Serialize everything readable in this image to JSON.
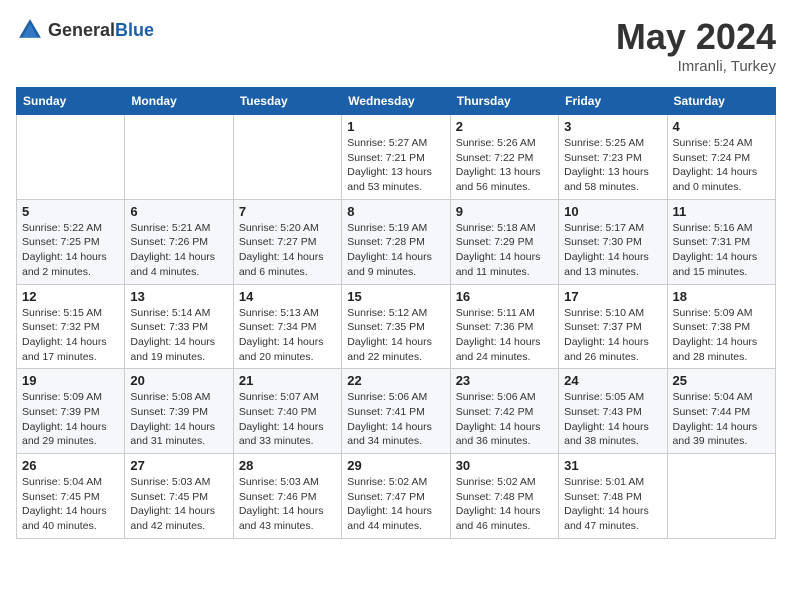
{
  "header": {
    "logo_general": "General",
    "logo_blue": "Blue",
    "month": "May 2024",
    "location": "Imranli, Turkey"
  },
  "weekdays": [
    "Sunday",
    "Monday",
    "Tuesday",
    "Wednesday",
    "Thursday",
    "Friday",
    "Saturday"
  ],
  "weeks": [
    [
      {
        "day": "",
        "info": ""
      },
      {
        "day": "",
        "info": ""
      },
      {
        "day": "",
        "info": ""
      },
      {
        "day": "1",
        "info": "Sunrise: 5:27 AM\nSunset: 7:21 PM\nDaylight: 13 hours\nand 53 minutes."
      },
      {
        "day": "2",
        "info": "Sunrise: 5:26 AM\nSunset: 7:22 PM\nDaylight: 13 hours\nand 56 minutes."
      },
      {
        "day": "3",
        "info": "Sunrise: 5:25 AM\nSunset: 7:23 PM\nDaylight: 13 hours\nand 58 minutes."
      },
      {
        "day": "4",
        "info": "Sunrise: 5:24 AM\nSunset: 7:24 PM\nDaylight: 14 hours\nand 0 minutes."
      }
    ],
    [
      {
        "day": "5",
        "info": "Sunrise: 5:22 AM\nSunset: 7:25 PM\nDaylight: 14 hours\nand 2 minutes."
      },
      {
        "day": "6",
        "info": "Sunrise: 5:21 AM\nSunset: 7:26 PM\nDaylight: 14 hours\nand 4 minutes."
      },
      {
        "day": "7",
        "info": "Sunrise: 5:20 AM\nSunset: 7:27 PM\nDaylight: 14 hours\nand 6 minutes."
      },
      {
        "day": "8",
        "info": "Sunrise: 5:19 AM\nSunset: 7:28 PM\nDaylight: 14 hours\nand 9 minutes."
      },
      {
        "day": "9",
        "info": "Sunrise: 5:18 AM\nSunset: 7:29 PM\nDaylight: 14 hours\nand 11 minutes."
      },
      {
        "day": "10",
        "info": "Sunrise: 5:17 AM\nSunset: 7:30 PM\nDaylight: 14 hours\nand 13 minutes."
      },
      {
        "day": "11",
        "info": "Sunrise: 5:16 AM\nSunset: 7:31 PM\nDaylight: 14 hours\nand 15 minutes."
      }
    ],
    [
      {
        "day": "12",
        "info": "Sunrise: 5:15 AM\nSunset: 7:32 PM\nDaylight: 14 hours\nand 17 minutes."
      },
      {
        "day": "13",
        "info": "Sunrise: 5:14 AM\nSunset: 7:33 PM\nDaylight: 14 hours\nand 19 minutes."
      },
      {
        "day": "14",
        "info": "Sunrise: 5:13 AM\nSunset: 7:34 PM\nDaylight: 14 hours\nand 20 minutes."
      },
      {
        "day": "15",
        "info": "Sunrise: 5:12 AM\nSunset: 7:35 PM\nDaylight: 14 hours\nand 22 minutes."
      },
      {
        "day": "16",
        "info": "Sunrise: 5:11 AM\nSunset: 7:36 PM\nDaylight: 14 hours\nand 24 minutes."
      },
      {
        "day": "17",
        "info": "Sunrise: 5:10 AM\nSunset: 7:37 PM\nDaylight: 14 hours\nand 26 minutes."
      },
      {
        "day": "18",
        "info": "Sunrise: 5:09 AM\nSunset: 7:38 PM\nDaylight: 14 hours\nand 28 minutes."
      }
    ],
    [
      {
        "day": "19",
        "info": "Sunrise: 5:09 AM\nSunset: 7:39 PM\nDaylight: 14 hours\nand 29 minutes."
      },
      {
        "day": "20",
        "info": "Sunrise: 5:08 AM\nSunset: 7:39 PM\nDaylight: 14 hours\nand 31 minutes."
      },
      {
        "day": "21",
        "info": "Sunrise: 5:07 AM\nSunset: 7:40 PM\nDaylight: 14 hours\nand 33 minutes."
      },
      {
        "day": "22",
        "info": "Sunrise: 5:06 AM\nSunset: 7:41 PM\nDaylight: 14 hours\nand 34 minutes."
      },
      {
        "day": "23",
        "info": "Sunrise: 5:06 AM\nSunset: 7:42 PM\nDaylight: 14 hours\nand 36 minutes."
      },
      {
        "day": "24",
        "info": "Sunrise: 5:05 AM\nSunset: 7:43 PM\nDaylight: 14 hours\nand 38 minutes."
      },
      {
        "day": "25",
        "info": "Sunrise: 5:04 AM\nSunset: 7:44 PM\nDaylight: 14 hours\nand 39 minutes."
      }
    ],
    [
      {
        "day": "26",
        "info": "Sunrise: 5:04 AM\nSunset: 7:45 PM\nDaylight: 14 hours\nand 40 minutes."
      },
      {
        "day": "27",
        "info": "Sunrise: 5:03 AM\nSunset: 7:45 PM\nDaylight: 14 hours\nand 42 minutes."
      },
      {
        "day": "28",
        "info": "Sunrise: 5:03 AM\nSunset: 7:46 PM\nDaylight: 14 hours\nand 43 minutes."
      },
      {
        "day": "29",
        "info": "Sunrise: 5:02 AM\nSunset: 7:47 PM\nDaylight: 14 hours\nand 44 minutes."
      },
      {
        "day": "30",
        "info": "Sunrise: 5:02 AM\nSunset: 7:48 PM\nDaylight: 14 hours\nand 46 minutes."
      },
      {
        "day": "31",
        "info": "Sunrise: 5:01 AM\nSunset: 7:48 PM\nDaylight: 14 hours\nand 47 minutes."
      },
      {
        "day": "",
        "info": ""
      }
    ]
  ]
}
